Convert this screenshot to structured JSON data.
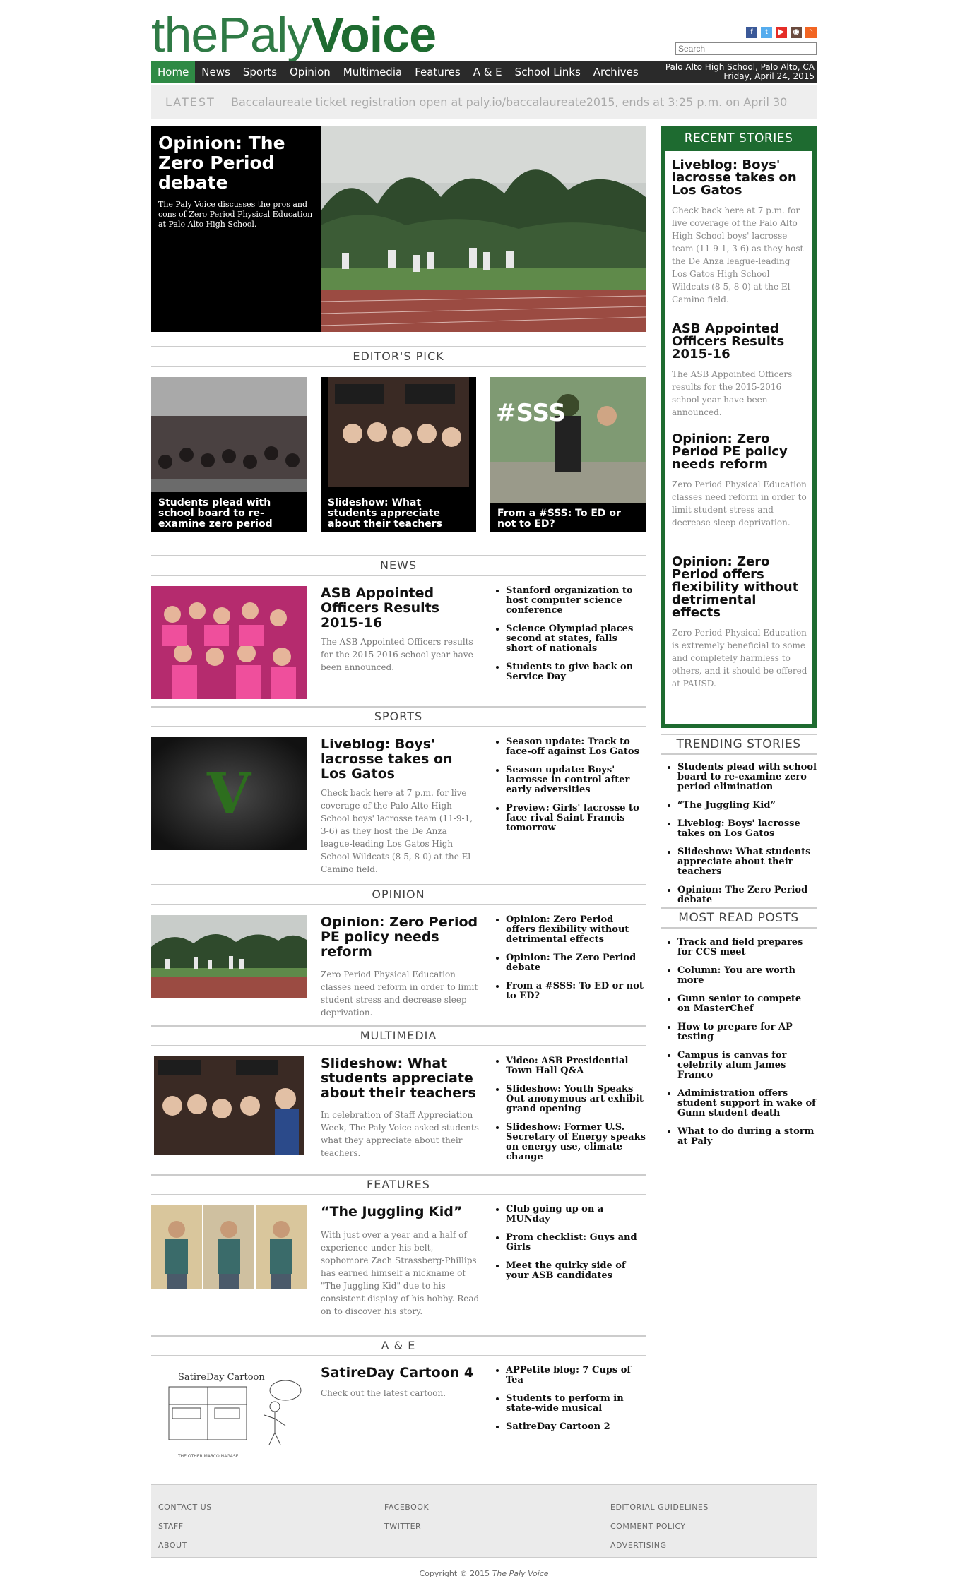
{
  "header": {
    "logo_the": "the",
    "logo_paly": "Paly",
    "logo_voice": "Voice",
    "search_placeholder": "Search",
    "social": [
      "facebook-icon",
      "twitter-icon",
      "youtube-icon",
      "instagram-icon",
      "rss-icon"
    ]
  },
  "nav": {
    "items": [
      "Home",
      "News",
      "Sports",
      "Opinion",
      "Multimedia",
      "Features",
      "A & E",
      "School Links",
      "Archives"
    ],
    "location": "Palo Alto High School, Palo Alto, CA",
    "date": "Friday, April 24, 2015"
  },
  "latest": {
    "label": "LATEST",
    "text": "Baccalaureate ticket registration open at paly.io/baccalaureate2015, ends at 3:25 p.m. on April 30"
  },
  "feature": {
    "title": "Opinion: The Zero Period debate",
    "desc": "The Paly Voice discusses the pros and cons of Zero Period Physical Education at Palo Alto High School."
  },
  "editors_pick": {
    "heading": "EDITOR'S PICK",
    "items": [
      {
        "caption": "Students plead with school board to re-examine zero period"
      },
      {
        "caption": "Slideshow: What students appreciate about their teachers"
      },
      {
        "caption": "From a #SSS: To ED or not to ED?"
      }
    ]
  },
  "news": {
    "heading": "NEWS",
    "title": "ASB Appointed Officers Results 2015-16",
    "desc": "The ASB Appointed Officers results for the 2015-2016 school year have been announced.",
    "bullets": [
      "Stanford organization to host computer science conference",
      "Science Olympiad places second at states, falls short of nationals",
      "Students to give back on Service Day"
    ]
  },
  "sports": {
    "heading": "SPORTS",
    "title": "Liveblog: Boys' lacrosse takes on Los Gatos",
    "desc": "Check back here at 7 p.m. for live coverage of the Palo Alto High School boys' lacrosse team (11-9-1, 3-6) as they host the De Anza league-leading Los Gatos High School Wildcats (8-5, 8-0) at the El Camino field.",
    "bullets": [
      "Season update: Track to face-off against Los Gatos",
      "Season update: Boys' lacrosse in control after early adversities",
      "Preview: Girls' lacrosse to face rival Saint Francis tomorrow"
    ]
  },
  "opinion": {
    "heading": "OPINION",
    "title": "Opinion: Zero Period PE policy needs reform",
    "desc": "Zero Period Physical Education classes need reform in order to limit student stress and decrease sleep deprivation.",
    "bullets": [
      "Opinion: Zero Period offers flexibility without detrimental effects",
      "Opinion: The Zero Period debate",
      "From a #SSS: To ED or not to ED?"
    ]
  },
  "multimedia": {
    "heading": "MULTIMEDIA",
    "title": "Slideshow: What students appreciate about their teachers",
    "desc": "In celebration of Staff Appreciation Week, The Paly Voice asked students what they appreciate about their teachers.",
    "bullets": [
      "Video: ASB Presidential Town Hall Q&A",
      "Slideshow: Youth Speaks Out anonymous art exhibit grand opening",
      "Slideshow: Former U.S. Secretary of Energy speaks on energy use, climate change"
    ]
  },
  "features": {
    "heading": "FEATURES",
    "title": "“The Juggling Kid”",
    "desc": "With just over a year and a half of experience under his belt, sophomore Zach Strassberg-Phillips has earned himself a nickname of \"The Juggling Kid\" due to his consistent display of his hobby. Read on to discover his story.",
    "bullets": [
      "Club going up on a MUNday",
      "Prom checklist: Guys and Girls",
      "Meet the quirky side of your ASB candidates"
    ]
  },
  "ae": {
    "heading": "A & E",
    "title": "SatireDay Cartoon 4",
    "desc": "Check out the latest cartoon.",
    "bullets": [
      "APPetite blog: 7 Cups of Tea",
      "Students to perform in state-wide musical",
      "SatireDay Cartoon 2"
    ],
    "cartoon_title": "SatireDay Cartoon",
    "cartoon_credit": "THE OTHER MARCO NAGASE"
  },
  "recent": {
    "heading": "RECENT STORIES",
    "items": [
      {
        "title": "Liveblog: Boys' lacrosse takes on Los Gatos",
        "desc": "Check back here at 7 p.m. for live coverage of the Palo Alto High School boys' lacrosse team (11-9-1, 3-6) as they host the De Anza league-leading Los Gatos High School Wildcats (8-5, 8-0) at the El Camino field."
      },
      {
        "title": "ASB Appointed Officers Results 2015-16",
        "desc": "The ASB Appointed Officers results for the 2015-2016 school year have been announced."
      },
      {
        "title": "Opinion: Zero Period PE policy needs reform",
        "desc": "Zero Period Physical Education classes need reform in order to limit student stress and decrease sleep deprivation."
      },
      {
        "title": "Opinion: Zero Period offers flexibility without detrimental effects",
        "desc": "Zero Period Physical Education is extremely beneficial to some and completely harmless to others, and it should be offered at PAUSD."
      }
    ]
  },
  "trending": {
    "heading": "TRENDING STORIES",
    "items": [
      "Students plead with school board to re-examine zero period elimination",
      "“The Juggling Kid”",
      "Liveblog: Boys' lacrosse takes on Los Gatos",
      "Slideshow: What students appreciate about their teachers",
      "Opinion: The Zero Period debate"
    ]
  },
  "most_read": {
    "heading": "MOST READ POSTS",
    "items": [
      "Track and field prepares for CCS meet",
      "Column: You are worth more",
      "Gunn senior to compete on MasterChef",
      "How to prepare for AP testing",
      "Campus is canvas for celebrity alum James Franco",
      "Administration offers student support in wake of Gunn student death",
      "What to do during a storm at Paly"
    ]
  },
  "footer": {
    "col1": [
      "CONTACT US",
      "STAFF",
      "ABOUT"
    ],
    "col2": [
      "FACEBOOK",
      "TWITTER"
    ],
    "col3": [
      "EDITORIAL GUIDELINES",
      "COMMENT POLICY",
      "ADVERTISING"
    ],
    "copyright": "Copyright © 2015",
    "publication": "The Paly Voice"
  },
  "colors": {
    "brand_green": "#1e6b30",
    "nav_dark": "#2a2a2a",
    "nav_active": "#2f8a45"
  }
}
